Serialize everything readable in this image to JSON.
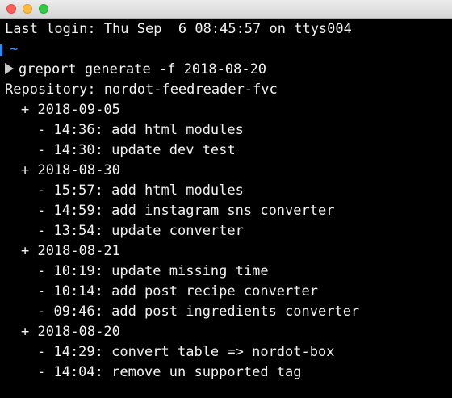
{
  "window": {
    "controls": [
      "close",
      "minimize",
      "zoom"
    ]
  },
  "terminal": {
    "last_login": "Last login: Thu Sep  6 08:45:57 on ttys004",
    "prompt_dir": "~",
    "command": "greport generate -f 2018-08-20",
    "repository_line": "Repository: nordot-feedreader-fvc",
    "groups": [
      {
        "date": "+ 2018-09-05",
        "commits": [
          "- 14:36: add html modules",
          "- 14:30: update dev test"
        ]
      },
      {
        "date": "+ 2018-08-30",
        "commits": [
          "- 15:57: add html modules",
          "- 14:59: add instagram sns converter",
          "- 13:54: update converter"
        ]
      },
      {
        "date": "+ 2018-08-21",
        "commits": [
          "- 10:19: update missing time",
          "- 10:14: add post recipe converter",
          "- 09:46: add post ingredients converter"
        ]
      },
      {
        "date": "+ 2018-08-20",
        "commits": [
          "- 14:29: convert table => nordot-box",
          "- 14:04: remove un supported tag"
        ]
      }
    ]
  },
  "colors": {
    "background": "#000000",
    "text": "#f2f2f2",
    "prompt_accent": "#3f8fff"
  },
  "icons": [
    "close-button",
    "minimize-button",
    "zoom-button",
    "prompt-arrow-icon"
  ]
}
